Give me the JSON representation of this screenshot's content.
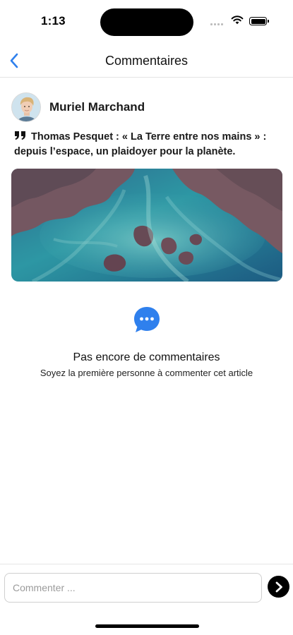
{
  "status_bar": {
    "time": "1:13"
  },
  "nav": {
    "title": "Commentaires",
    "back_icon": "chevron-left-icon"
  },
  "post": {
    "author_name": "Muriel Marchand",
    "quote_icon": "quote-icon",
    "article_title": "Thomas Pesquet : « La Terre entre nos mains » : depuis l’espace, un plaidoyer pour la planète."
  },
  "empty_state": {
    "icon": "comment-bubble-icon",
    "title": "Pas encore de commentaires",
    "subtitle": "Soyez la première personne à commenter cet article"
  },
  "composer": {
    "placeholder": "Commenter ...",
    "value": "",
    "send_icon": "send-arrow-icon"
  },
  "colors": {
    "accent_blue": "#2f80ed",
    "text": "#111111",
    "border": "#e3e3e3"
  }
}
